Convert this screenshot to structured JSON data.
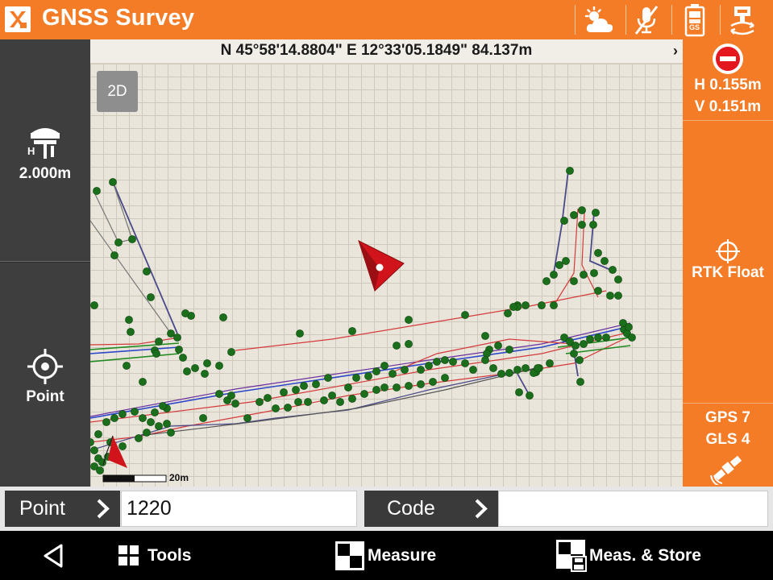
{
  "header": {
    "title": "GNSS Survey",
    "icons": [
      "app-logo-icon",
      "weather-cloud-sun-icon",
      "microphone-off-icon",
      "battery-gs-icon",
      "receiver-settings-icon"
    ],
    "battery_label": "GS"
  },
  "left_panel": {
    "antenna_height": "2.000m",
    "antenna_letter": "H",
    "point_mode_label": "Point"
  },
  "coordinate_bar": {
    "text": "N 45°58'14.8804\" E 12°33'05.1849\" 84.137m"
  },
  "map": {
    "view_mode_label": "2D",
    "scale_label": "20m"
  },
  "right_panel": {
    "precision_h": "H 0.155m",
    "precision_v": "V 0.151m",
    "fix_status": "RTK Float",
    "gps_count": "GPS 7",
    "glonass_count": "GLS 4"
  },
  "input_row": {
    "point_label": "Point",
    "point_value": "1220",
    "code_label": "Code",
    "code_value": ""
  },
  "bottom_nav": {
    "tools_label": "Tools",
    "measure_label": "Measure",
    "meas_store_label": "Meas. & Store"
  },
  "colors": {
    "accent_orange": "#f47c26",
    "dark_panel": "#3e3e3e",
    "point_green": "#1d6e1d",
    "cursor_red": "#d1141b"
  }
}
